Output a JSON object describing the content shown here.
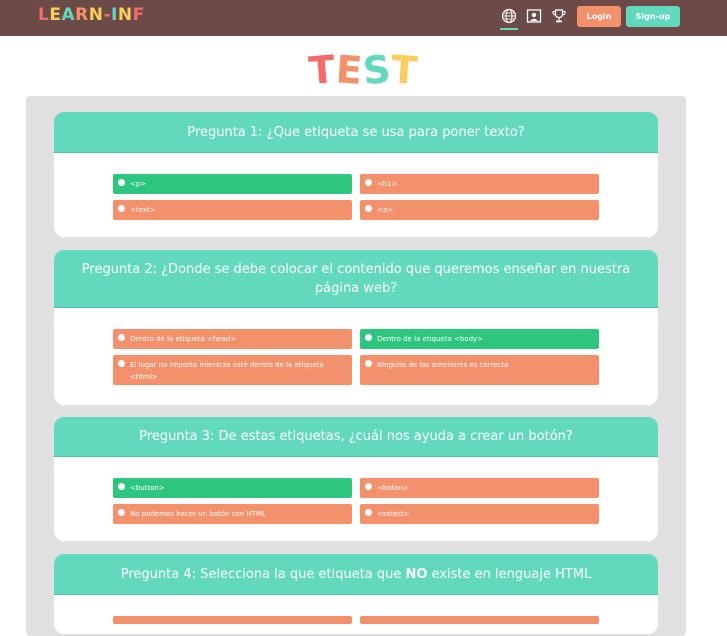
{
  "app": {
    "logo_text": "Learn-inf",
    "page_title": "Test",
    "colors": {
      "navbar": "#6b4a47",
      "accent": "#62d9bd",
      "correct": "#2ec67e",
      "wrong": "#f3916c"
    }
  },
  "navbar": {
    "icons": [
      "globe-icon",
      "user-card-icon",
      "trophy-icon"
    ],
    "login_label": "Login",
    "signup_label": "Sign-up"
  },
  "questions": [
    {
      "title": "Pregunta 1: ¿Que etiqueta se usa para poner texto?",
      "options": [
        {
          "label": "<p>",
          "state": "correct"
        },
        {
          "label": "<h1>",
          "state": "wrong"
        },
        {
          "label": "<text>",
          "state": "wrong"
        },
        {
          "label": "<a>",
          "state": "wrong"
        }
      ]
    },
    {
      "title": "Pregunta 2: ¿Donde se debe colocar el contenido que queremos enseñar en nuestra página web?",
      "options": [
        {
          "label": "Dentro de la etiqueta <head>",
          "state": "wrong"
        },
        {
          "label": "Dentro de la etiqueta <body>",
          "state": "correct"
        },
        {
          "label": "El lugar no importa mientras esté dentro de la etiqueta <html>",
          "state": "wrong"
        },
        {
          "label": "Ninguna de las anteriores es correcta",
          "state": "wrong"
        }
      ]
    },
    {
      "title": "Pregunta 3: De estas etiquetas, ¿cuál nos ayuda a crear un botón?",
      "options": [
        {
          "label": "<button>",
          "state": "correct"
        },
        {
          "label": "<boton>",
          "state": "wrong"
        },
        {
          "label": "No podemos hacer un botón con HTML",
          "state": "wrong"
        },
        {
          "label": "<select>",
          "state": "wrong"
        }
      ]
    },
    {
      "title_prefix": "Pregunta 4: Selecciona la que etiqueta que ",
      "title_emphasis": "NO",
      "title_suffix": " existe en lenguaje HTML",
      "options": []
    }
  ]
}
